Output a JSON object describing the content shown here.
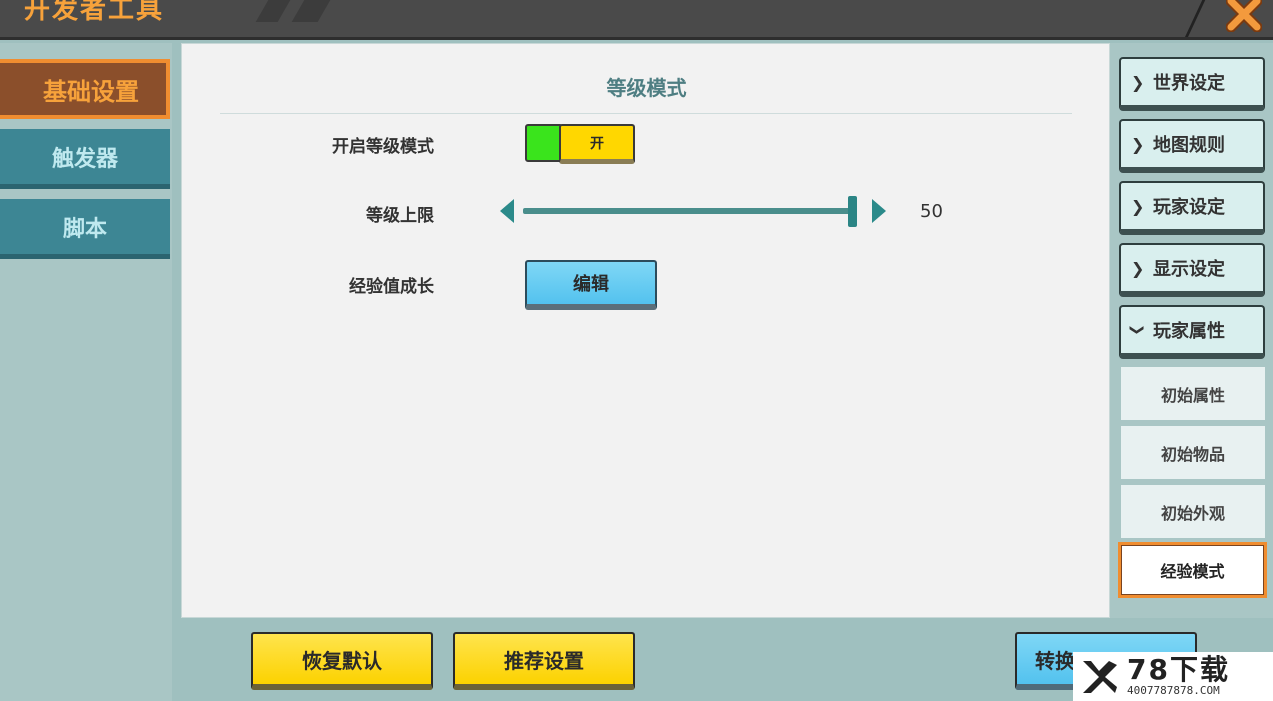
{
  "window": {
    "title": "开发者工具",
    "close_icon": "close-x-icon",
    "accent_color": "#f7a23b"
  },
  "left_sidebar": {
    "tabs": [
      {
        "label": "基础设置",
        "active": true
      },
      {
        "label": "触发器",
        "active": false
      },
      {
        "label": "脚本",
        "active": false
      }
    ]
  },
  "main": {
    "section_title": "等级模式",
    "rows": {
      "level_mode": {
        "label": "开启等级模式",
        "toggle_label": "开",
        "enabled": true
      },
      "level_cap": {
        "label": "等级上限",
        "value": "50",
        "fraction": 1.0
      },
      "exp_growth": {
        "label": "经验值成长",
        "button_label": "编辑"
      }
    }
  },
  "right_sidebar": {
    "categories": [
      {
        "label": "世界设定",
        "expanded": false
      },
      {
        "label": "地图规则",
        "expanded": false
      },
      {
        "label": "玩家设定",
        "expanded": false
      },
      {
        "label": "显示设定",
        "expanded": false
      },
      {
        "label": "玩家属性",
        "expanded": true
      }
    ],
    "sub_items": [
      {
        "label": "初始属性",
        "active": false
      },
      {
        "label": "初始物品",
        "active": false
      },
      {
        "label": "初始外观",
        "active": false
      },
      {
        "label": "经验模式",
        "active": true
      }
    ]
  },
  "bottom": {
    "reset_label": "恢复默认",
    "recommend_label": "推荐设置",
    "convert_label": "转换"
  },
  "watermark": {
    "main": "78下载",
    "sub": "4007787878.COM"
  }
}
